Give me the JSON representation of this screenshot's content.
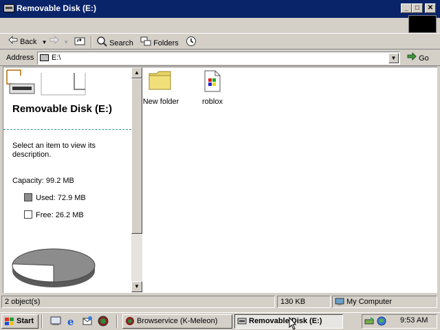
{
  "window": {
    "title": "Removable Disk (E:)"
  },
  "caption_buttons": {
    "minimize": "_",
    "maximize": "□",
    "close": "✕"
  },
  "toolbar": {
    "back_label": "Back",
    "search_label": "Search",
    "folders_label": "Folders"
  },
  "address": {
    "label": "Address",
    "value": "E:\\",
    "go_label": "Go"
  },
  "left_panel": {
    "title": "Removable Disk (E:)",
    "description": "Select an item to view its description.",
    "capacity": "Capacity: 99.2 MB",
    "used": "Used: 72.9 MB",
    "free": "Free: 26.2 MB",
    "usage": {
      "used_mb": 72.9,
      "free_mb": 26.2,
      "used_fraction": 0.735
    }
  },
  "files": [
    {
      "name": "New folder",
      "icon": "folder-icon"
    },
    {
      "name": "roblox",
      "icon": "application-icon"
    }
  ],
  "status": {
    "objects": "2 object(s)",
    "size": "130 KB",
    "zone": "My Computer"
  },
  "taskbar": {
    "start_label": "Start",
    "tasks": [
      {
        "label": "Browservice (K-Meleon)",
        "active": false
      },
      {
        "label": "Removable Disk (E:)",
        "active": true
      }
    ],
    "clock": "9:53 AM"
  },
  "colors": {
    "titlebar": "#0a246a",
    "face": "#d4d0c8",
    "used_slice": "#8c8c8c",
    "free_slice": "#ffffff"
  }
}
